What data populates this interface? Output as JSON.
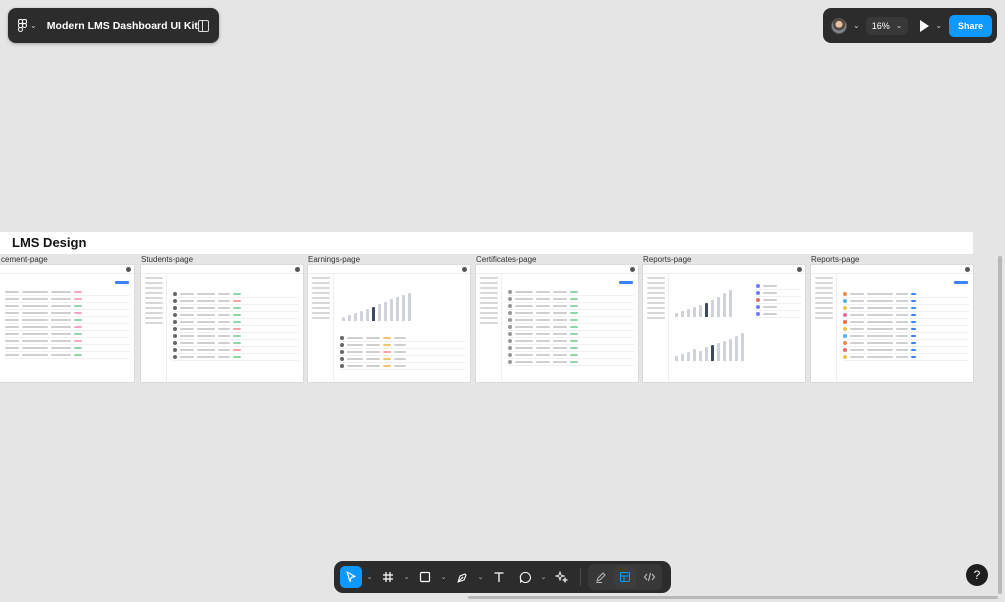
{
  "file": {
    "title": "Modern LMS Dashboard UI Kit"
  },
  "toolbar_right": {
    "zoom": "16%",
    "share_label": "Share"
  },
  "canvas": {
    "section_title": "LMS Design",
    "frames": [
      {
        "label": "cement-page"
      },
      {
        "label": "Students-page"
      },
      {
        "label": "Earnings-page"
      },
      {
        "label": "Certificates-page"
      },
      {
        "label": "Reports-page"
      },
      {
        "label": "Reports-page"
      }
    ]
  },
  "tools": {
    "move": "move-tool",
    "frame": "frame-tool",
    "shape": "rectangle-tool",
    "pen": "pen-tool",
    "text": "text-tool",
    "comment": "comment-tool",
    "actions": "actions-tool",
    "draw": "draw-mode",
    "design": "design-mode",
    "dev": "dev-mode"
  },
  "help": {
    "label": "?"
  },
  "colors": {
    "accent": "#0d99ff",
    "chrome": "#2c2c2c",
    "canvas": "#e5e5e5"
  }
}
